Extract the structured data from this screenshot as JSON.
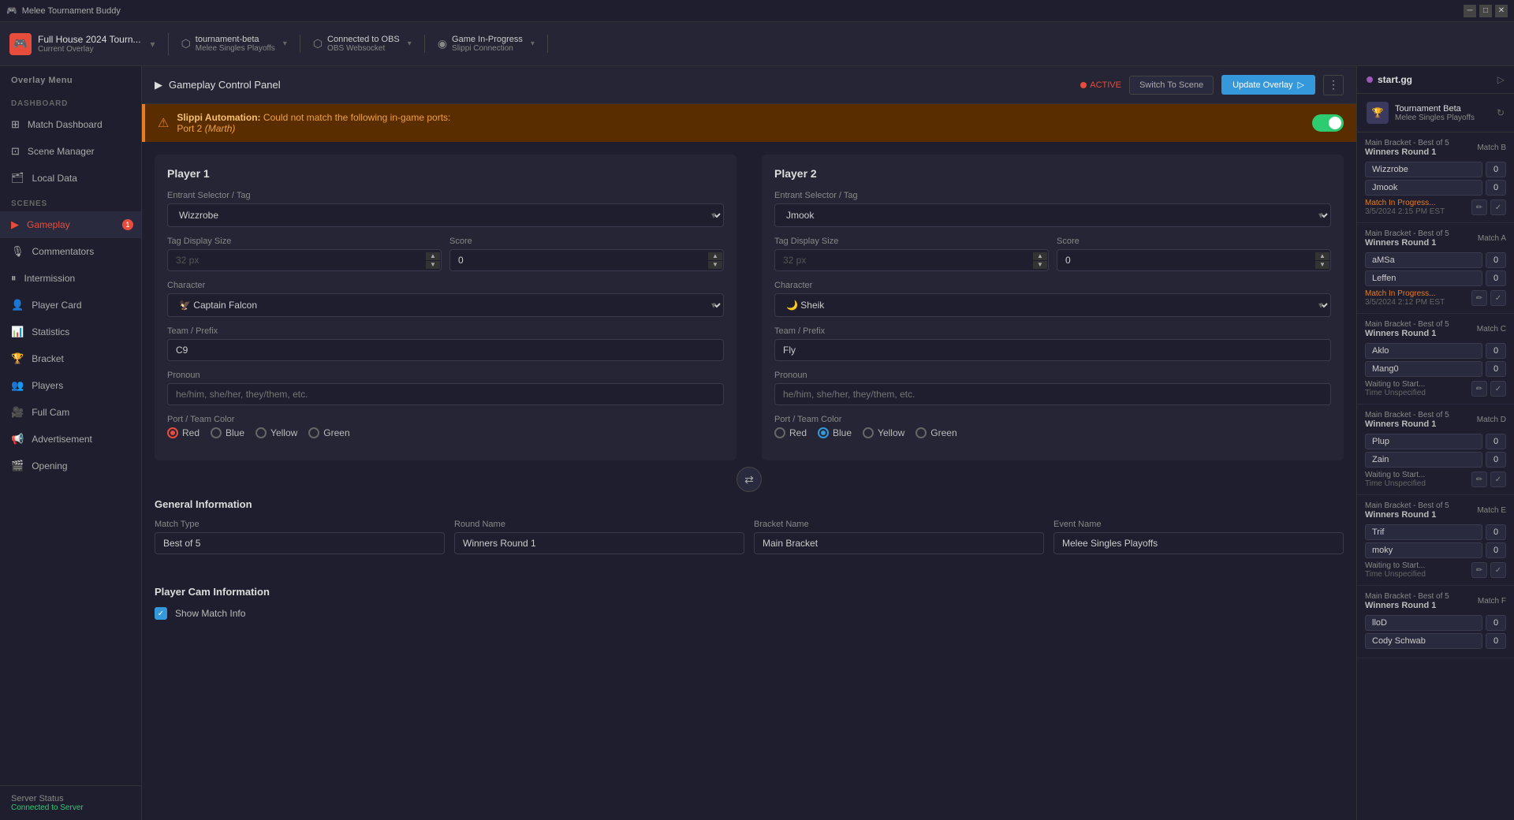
{
  "app": {
    "title": "Melee Tournament Buddy",
    "minimize": "─",
    "restore": "□",
    "close": "✕"
  },
  "toolbar": {
    "brand": {
      "name": "Full House 2024 Tourn...",
      "sub": "Current Overlay"
    },
    "obs": {
      "label": "tournament-beta",
      "sub": "Melee Singles Playoffs"
    },
    "connection": {
      "label": "Connected to OBS",
      "sub": "OBS Websocket"
    },
    "game": {
      "label": "Game In-Progress",
      "sub": "Slippi Connection"
    }
  },
  "sidebar": {
    "overlay_menu_label": "Overlay Menu",
    "dashboard_label": "DASHBOARD",
    "scenes_label": "SCENES",
    "items_dashboard": [
      {
        "id": "match-dashboard",
        "label": "Match Dashboard",
        "icon": "⊞"
      }
    ],
    "items_scenes": [
      {
        "id": "scene-manager",
        "label": "Scene Manager",
        "icon": "⊡"
      },
      {
        "id": "local-data",
        "label": "Local Data",
        "icon": "🗂"
      },
      {
        "id": "gameplay",
        "label": "Gameplay",
        "icon": "▶",
        "active": true,
        "badge": "1"
      },
      {
        "id": "commentators",
        "label": "Commentators",
        "icon": "🎙"
      },
      {
        "id": "intermission",
        "label": "Intermission",
        "icon": "⏸"
      },
      {
        "id": "player-card",
        "label": "Player Card",
        "icon": "👤"
      },
      {
        "id": "statistics",
        "label": "Statistics",
        "icon": "📊"
      },
      {
        "id": "bracket",
        "label": "Bracket",
        "icon": "🏆"
      },
      {
        "id": "players",
        "label": "Players",
        "icon": "👥"
      },
      {
        "id": "full-cam",
        "label": "Full Cam",
        "icon": "🎥"
      },
      {
        "id": "advertisement",
        "label": "Advertisement",
        "icon": "📢"
      },
      {
        "id": "opening",
        "label": "Opening",
        "icon": "🎬"
      }
    ],
    "footer": {
      "status_label": "Server Status",
      "status_value": "Connected to Server"
    }
  },
  "content": {
    "header": {
      "icon": "▶",
      "title": "Gameplay Control Panel",
      "active_label": "ACTIVE",
      "switch_scene_label": "Switch To Scene",
      "update_overlay_label": "Update Overlay"
    },
    "alert": {
      "prefix": "Slippi Automation:",
      "message": "Could not match the following in-game ports:",
      "port": "Port 2",
      "character": "(Marth)"
    },
    "player1": {
      "title": "Player 1",
      "entrant_label": "Entrant Selector / Tag",
      "entrant_value": "Wizzrobe",
      "tag_size_label": "Tag Display Size",
      "tag_size_value": "32 px",
      "score_label": "Score",
      "score_value": "0",
      "character_label": "Character",
      "character_value": "Captain Falcon",
      "character_icon": "🦅",
      "team_label": "Team / Prefix",
      "team_value": "C9",
      "pronoun_label": "Pronoun",
      "pronoun_placeholder": "he/him, she/her, they/them, etc.",
      "port_label": "Port / Team Color",
      "colors": [
        "Red",
        "Blue",
        "Yellow",
        "Green"
      ],
      "selected_color": "Red"
    },
    "player2": {
      "title": "Player 2",
      "entrant_label": "Entrant Selector / Tag",
      "entrant_value": "Jmook",
      "tag_size_label": "Tag Display Size",
      "tag_size_value": "32 px",
      "score_label": "Score",
      "score_value": "0",
      "character_label": "Character",
      "character_value": "Sheik",
      "character_icon": "🌙",
      "team_label": "Team / Prefix",
      "team_value": "Fly",
      "pronoun_label": "Pronoun",
      "pronoun_placeholder": "he/him, she/her, they/them, etc.",
      "port_label": "Port / Team Color",
      "colors": [
        "Red",
        "Blue",
        "Yellow",
        "Green"
      ],
      "selected_color": "Blue"
    },
    "general_info": {
      "title": "General Information",
      "match_type_label": "Match Type",
      "match_type_value": "Best of 5",
      "round_name_label": "Round Name",
      "round_name_value": "Winners Round 1",
      "bracket_name_label": "Bracket Name",
      "bracket_name_value": "Main Bracket",
      "event_name_label": "Event Name",
      "event_name_value": "Melee Singles Playoffs"
    },
    "player_cam": {
      "title": "Player Cam Information",
      "show_match_label": "Show Match Info",
      "show_match_checked": true
    }
  },
  "right_panel": {
    "title": "start.gg",
    "tournament": {
      "name": "Tournament Beta",
      "sub": "Melee Singles Playoffs"
    },
    "matches": [
      {
        "id": "match-b",
        "bracket": "Main Bracket - Best of 5",
        "round": "Winners Round 1",
        "letter": "Match B",
        "players": [
          {
            "name": "Wizzrobe",
            "score": "0"
          },
          {
            "name": "Jmook",
            "score": "0"
          }
        ],
        "status": "in_progress",
        "status_label": "Match In Progress...",
        "time": "3/5/2024 2:15 PM EST"
      },
      {
        "id": "match-a",
        "bracket": "Main Bracket - Best of 5",
        "round": "Winners Round 1",
        "letter": "Match A",
        "players": [
          {
            "name": "aMSa",
            "score": "0"
          },
          {
            "name": "Leffen",
            "score": "0"
          }
        ],
        "status": "in_progress",
        "status_label": "Match In Progress...",
        "time": "3/5/2024 2:12 PM EST"
      },
      {
        "id": "match-c",
        "bracket": "Main Bracket - Best of 5",
        "round": "Winners Round 1",
        "letter": "Match C",
        "players": [
          {
            "name": "Aklo",
            "score": "0"
          },
          {
            "name": "Mang0",
            "score": "0"
          }
        ],
        "status": "waiting",
        "status_label": "Waiting to Start...",
        "time": "Time Unspecified"
      },
      {
        "id": "match-d",
        "bracket": "Main Bracket - Best of 5",
        "round": "Winners Round 1",
        "letter": "Match D",
        "players": [
          {
            "name": "Plup",
            "score": "0"
          },
          {
            "name": "Zain",
            "score": "0"
          }
        ],
        "status": "waiting",
        "status_label": "Waiting to Start...",
        "time": "Time Unspecified"
      },
      {
        "id": "match-e",
        "bracket": "Main Bracket - Best of 5",
        "round": "Winners Round 1",
        "letter": "Match E",
        "players": [
          {
            "name": "Trif",
            "score": "0"
          },
          {
            "name": "moky",
            "score": "0"
          }
        ],
        "status": "waiting",
        "status_label": "Waiting to Start...",
        "time": "Time Unspecified"
      },
      {
        "id": "match-f",
        "bracket": "Main Bracket - Best of 5",
        "round": "Winners Round 1",
        "letter": "Match F",
        "players": [
          {
            "name": "lloD",
            "score": "0"
          },
          {
            "name": "Cody Schwab",
            "score": "0"
          }
        ],
        "status": "waiting",
        "status_label": "Waiting to Start...",
        "time": "Time Unspecified"
      }
    ]
  }
}
